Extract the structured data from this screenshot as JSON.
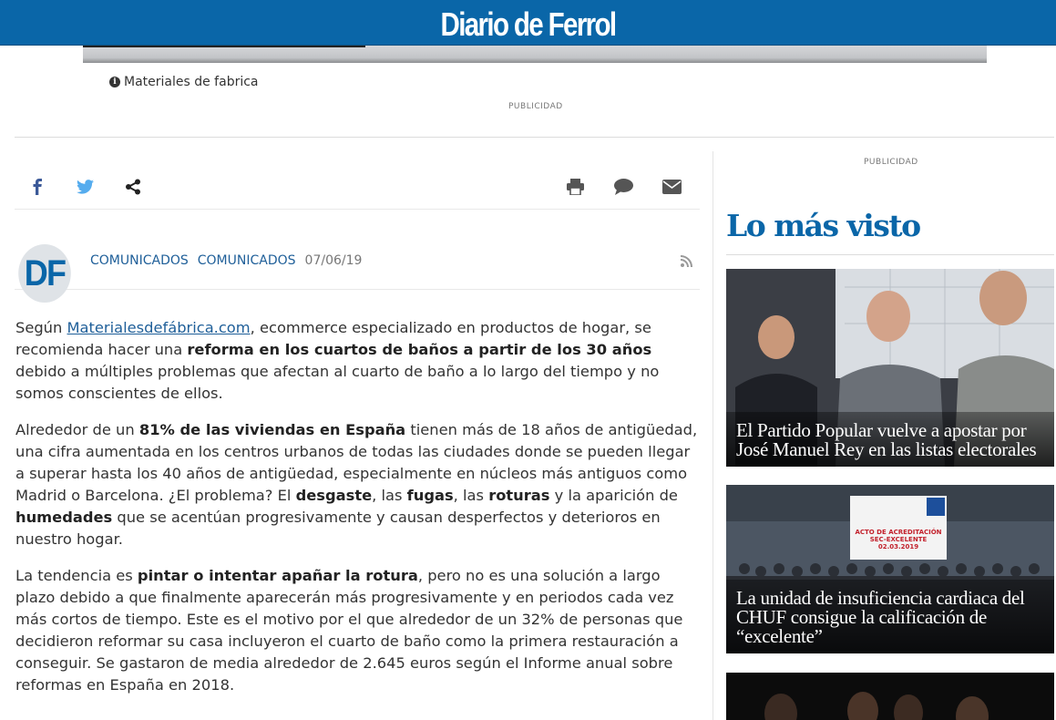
{
  "header": {
    "logo": "Diario de Ferrol",
    "bg_color": "#0a66a8"
  },
  "hero": {
    "caption": "Materiales de fabrica",
    "caption_icon": "info-icon"
  },
  "ads": {
    "top_label": "PUBLICIDAD",
    "side_label": "PUBLICIDAD"
  },
  "share": {
    "left_icons": [
      "facebook-icon",
      "twitter-icon",
      "share-icon"
    ],
    "right_icons": [
      "print-icon",
      "comment-icon",
      "email-icon"
    ]
  },
  "author": {
    "avatar_text": "DF",
    "category1": "COMUNICADOS",
    "category2": "COMUNICADOS",
    "date": "07/06/19",
    "rss_icon": "rss-icon"
  },
  "article": {
    "p1": {
      "a": "Según ",
      "link": "Materialesdefábrica.com",
      "b": ", ecommerce especializado en productos de hogar, se recomienda hacer una ",
      "bold": "reforma en los cuartos de baños a partir de los 30 años",
      "c": " debido a múltiples problemas que afectan al cuarto de baño a lo largo del tiempo y no somos conscientes de ellos."
    },
    "p2": {
      "a": "Alrededor de un ",
      "bold1": "81% de las viviendas en España",
      "b": " tienen más de 18 años de antigüedad, una cifra aumentada en los centros urbanos de todas las ciudades donde se pueden llegar a  superar hasta los 40 años de antigüedad, especialmente en núcleos más antiguos como Madrid o Barcelona. ¿El problema? El ",
      "bold2": "desgaste",
      "c": ", las ",
      "bold3": "fugas",
      "d": ", las ",
      "bold4": "roturas",
      "e": " y la aparición de ",
      "bold5": "humedades",
      "f": " que se acentúan progresivamente y causan desperfectos y deterioros en nuestro hogar."
    },
    "p3": {
      "a": "La tendencia es ",
      "bold": "pintar o intentar apañar la rotura",
      "b": ", pero no es una solución a largo plazo debido a que finalmente aparecerán más progresivamente y en periodos cada vez más cortos de tiempo. Este es el motivo por el que alrededor de un 32% de personas que decidieron reformar su casa incluyeron el cuarto de baño como la primera restauración a conseguir. Se gastaron de media alrededor de 2.645 euros según el Informe anual sobre reformas en España en 2018."
    }
  },
  "sidebar": {
    "title": "Lo más visto",
    "cards": [
      {
        "headline": "El Partido Popular vuelve a apostar por José Manuel Rey en las listas electorales"
      },
      {
        "headline": "La unidad de insuficiencia cardiaca del CHUF consigue la calificación de “excelente”"
      },
      {
        "headline": ""
      }
    ],
    "card2_sign": {
      "line1": "ACTO DE ACREDITACIÓN",
      "line2": "SEC-EXCELENTE",
      "line3": "02.03.2019"
    }
  }
}
